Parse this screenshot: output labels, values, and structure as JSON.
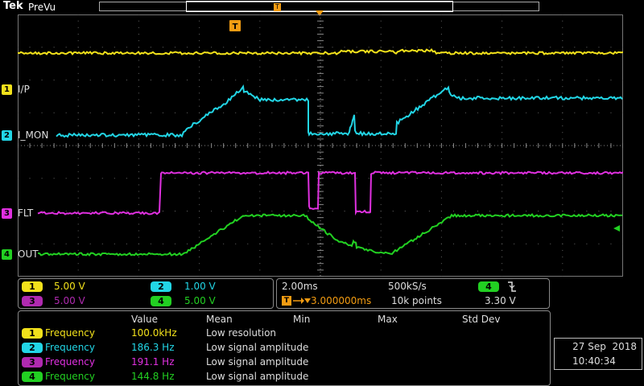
{
  "header": {
    "brand": "Tek",
    "mode": "PreVu",
    "trigger_marker": "T"
  },
  "colors": {
    "ch1": "#f2e11b",
    "ch2": "#22d6e6",
    "ch3": "#e030e0",
    "ch4": "#22d022",
    "trigger": "#f39c12"
  },
  "channels": [
    {
      "num": "1",
      "label": "I/P",
      "scale": "5.00 V"
    },
    {
      "num": "2",
      "label": "I_MON",
      "scale": "1.00 V"
    },
    {
      "num": "3",
      "label": "FLT",
      "scale": "5.00 V"
    },
    {
      "num": "4",
      "label": "OUT",
      "scale": "5.00 V"
    }
  ],
  "timebase": {
    "horizontal": "2.00ms",
    "sample_rate": "500kS/s",
    "trigger_source": "4",
    "trigger_slope_icon": "falling-edge-icon",
    "trigger_level": "3.30 V",
    "trigger_delay": "3.000000ms",
    "record_length": "10k points"
  },
  "measurements": {
    "headers": [
      "Value",
      "Mean",
      "Min",
      "Max",
      "Std Dev"
    ],
    "rows": [
      {
        "channel": "1",
        "type": "Frequency",
        "value": "100.0kHz",
        "status": "Low resolution"
      },
      {
        "channel": "2",
        "type": "Frequency",
        "value": "186.3 Hz",
        "status": "Low signal amplitude"
      },
      {
        "channel": "3",
        "type": "Frequency",
        "value": "191.1 Hz",
        "status": "Low signal amplitude"
      },
      {
        "channel": "4",
        "type": "Frequency",
        "value": "144.8 Hz",
        "status": "Low signal amplitude"
      }
    ]
  },
  "datetime": {
    "date": "27 Sep  2018",
    "time": "10:40:34"
  }
}
